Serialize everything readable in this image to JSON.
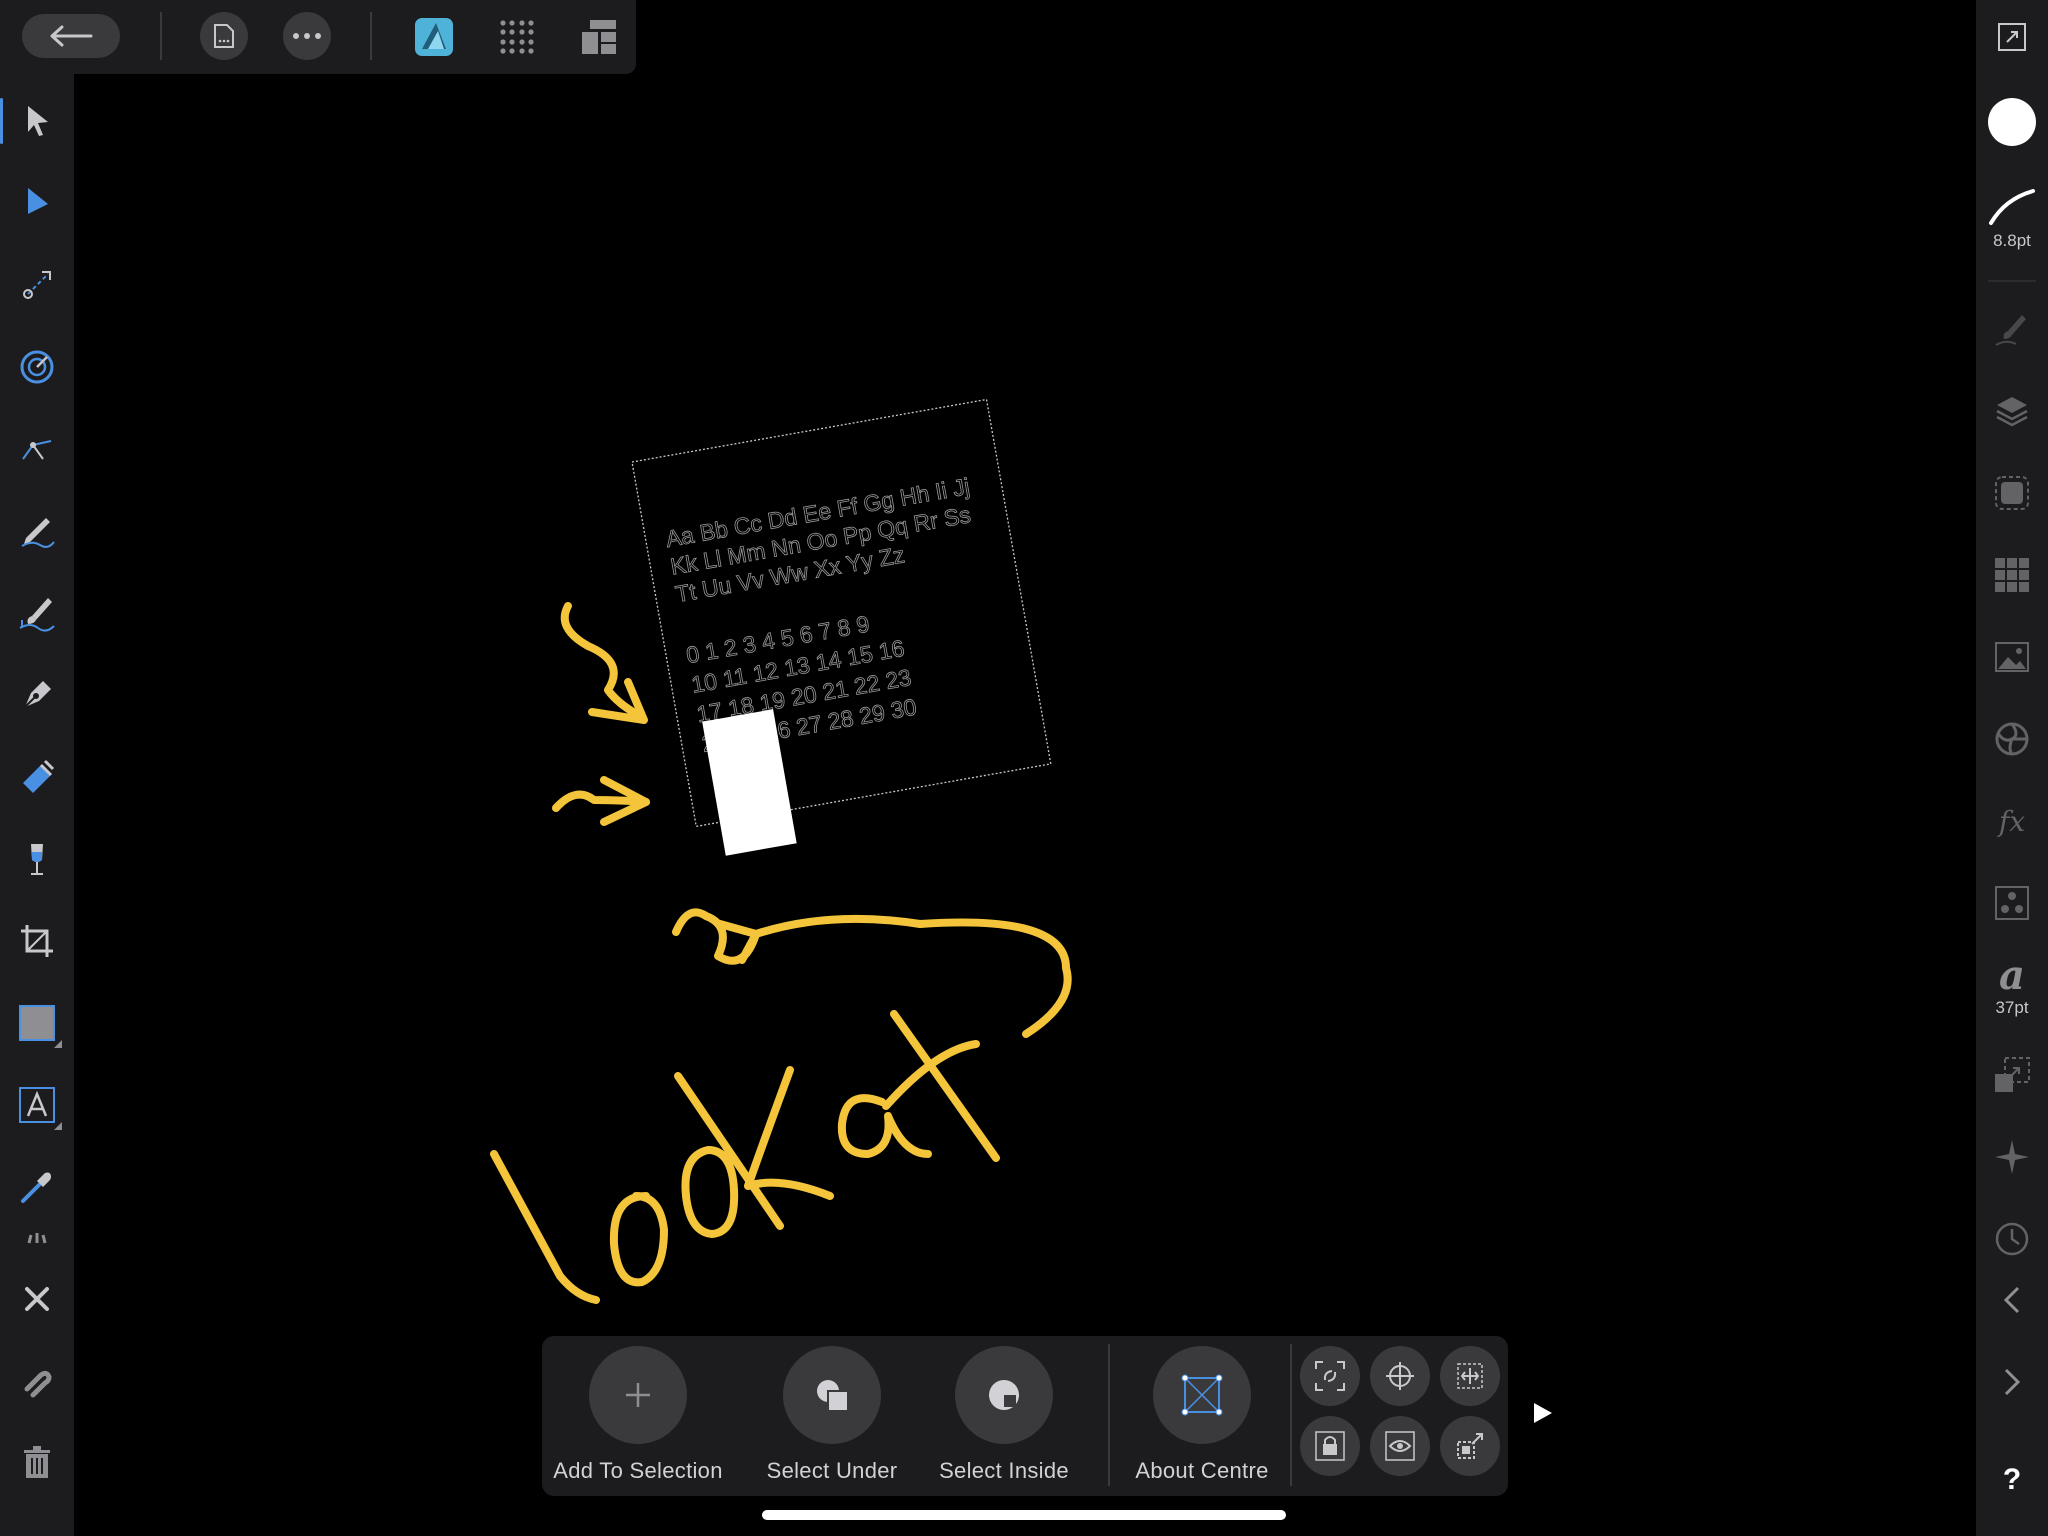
{
  "app": {
    "name": "Affinity Designer"
  },
  "top_toolbar": {
    "icons": [
      "back-arrow-icon",
      "document-icon",
      "more-icon",
      "designer-persona-icon",
      "pixel-persona-icon",
      "export-persona-icon"
    ]
  },
  "left_toolbar": {
    "tools": [
      "move-tool",
      "node-tool",
      "point-transform-tool",
      "corner-tool",
      "contour-tool",
      "pencil-tool",
      "vector-brush-tool",
      "pen-tool",
      "fill-tool",
      "transparency-tool",
      "crop-tool",
      "rectangle-tool",
      "artistic-text-tool",
      "color-picker-tool"
    ],
    "active_tool": "move-tool"
  },
  "right_toolbar": {
    "stroke_width_label": "8.8pt",
    "font_size_label": "37pt",
    "font_glyph": "a",
    "fx_label": "fx",
    "help_label": "?",
    "fill_color": "#ffffff"
  },
  "canvas": {
    "specimen_lines": [
      "Aa Bb Cc Dd Ee Ff Gg Hh Ii Jj",
      "Kk Ll Mm Nn Oo Pp Qq Rr Ss",
      "Tt Uu Vv Ww Xx Yy Zz"
    ],
    "number_lines": [
      "0 1 2 3 4 5 6 7 8 9",
      "10 11 12 13 14 15 16",
      "17 18 19 20 21 22 23",
      "24 25 26 27 28 29 30"
    ],
    "annotation_color": "#f4c53a"
  },
  "context_toolbar": {
    "add_to_selection": "Add To Selection",
    "select_under": "Select Under",
    "select_inside": "Select Inside",
    "about_centre": "About Centre"
  },
  "colors": {
    "accent": "#4a90e2",
    "panel": "#1c1c1e",
    "button": "#3a3a3c"
  }
}
